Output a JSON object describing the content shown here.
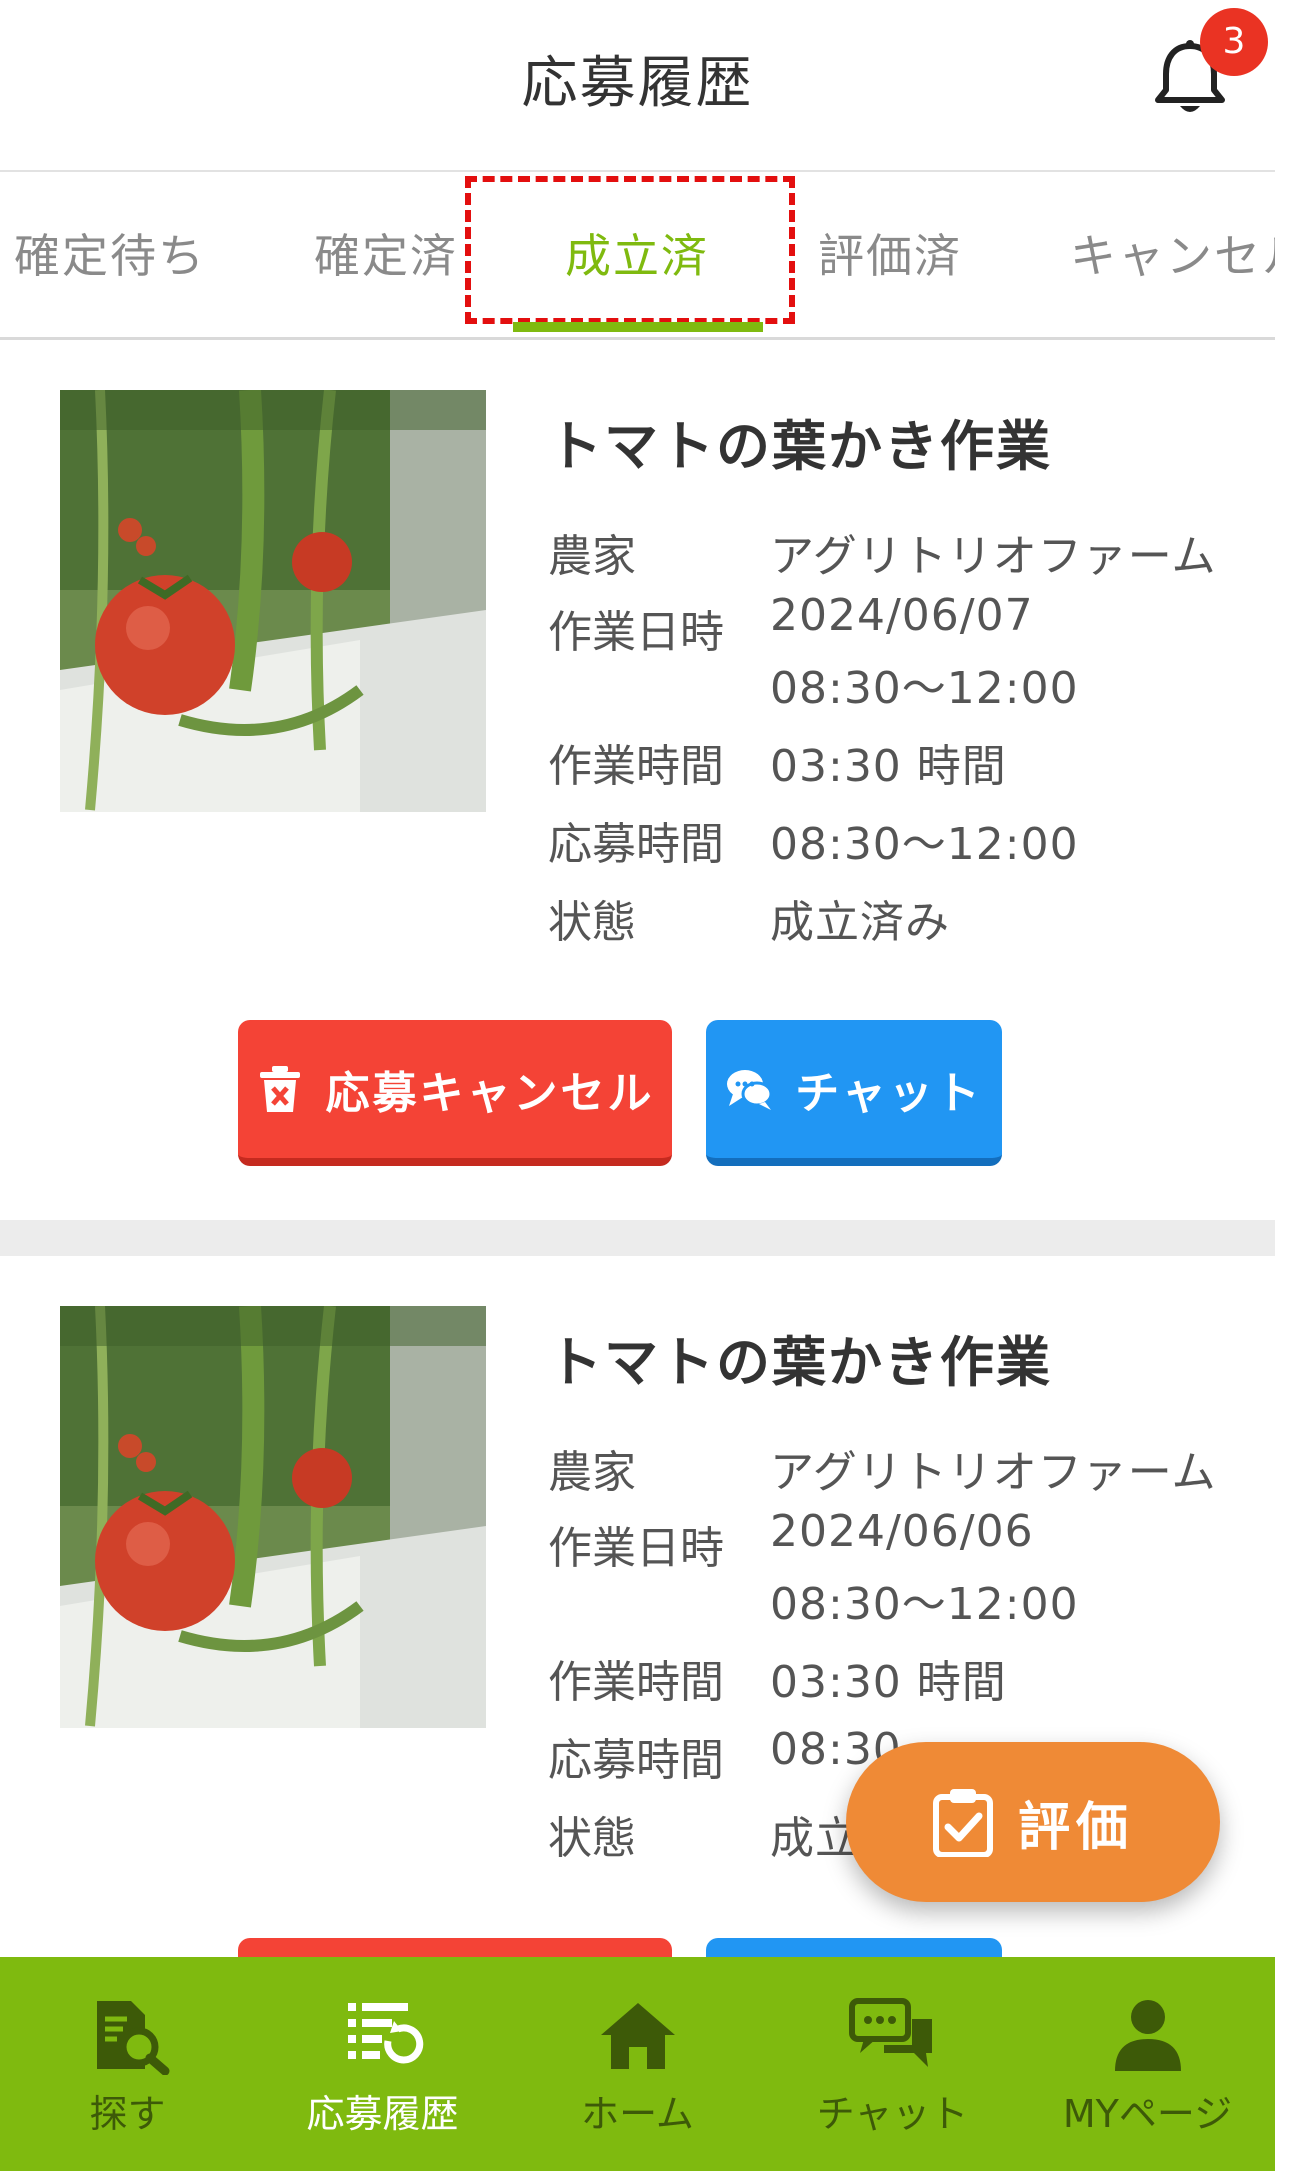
{
  "header": {
    "title": "応募履歴",
    "notification_count": "3"
  },
  "tabs": [
    {
      "label": "確定待ち"
    },
    {
      "label": "確定済"
    },
    {
      "label": "成立済",
      "active": true
    },
    {
      "label": "評価済"
    },
    {
      "label": "キャンセル"
    }
  ],
  "labels": {
    "farmer": "農家",
    "work_date": "作業日時",
    "work_hours": "作業時間",
    "apply_time": "応募時間",
    "status": "状態"
  },
  "jobs": [
    {
      "title": "トマトの葉かき作業",
      "farmer": "アグリトリオファーム",
      "date": "2024/06/07",
      "time_range": "08:30〜12:00",
      "work_hours": "03:30 時間",
      "apply_time": "08:30〜12:00",
      "status": "成立済み"
    },
    {
      "title": "トマトの葉かき作業",
      "farmer": "アグリトリオファーム",
      "date": "2024/06/06",
      "time_range": "08:30〜12:00",
      "work_hours": "03:30 時間",
      "apply_time_visible": "08:30",
      "status_visible": "成立"
    }
  ],
  "buttons": {
    "cancel": "応募キャンセル",
    "chat": "チャット",
    "evaluate": "評価"
  },
  "nav": [
    {
      "label": "探す",
      "icon": "search-document-icon"
    },
    {
      "label": "応募履歴",
      "icon": "history-list-icon",
      "active": true
    },
    {
      "label": "ホーム",
      "icon": "home-icon"
    },
    {
      "label": "チャット",
      "icon": "chat-bubbles-icon"
    },
    {
      "label": "MYページ",
      "icon": "user-icon"
    }
  ],
  "colors": {
    "accent_green": "#7fba0f",
    "cancel_red": "#f44336",
    "chat_blue": "#2196f3",
    "evaluate_orange": "#ef8a36",
    "badge_red": "#ea3323",
    "highlight_red": "#e30f0f"
  }
}
